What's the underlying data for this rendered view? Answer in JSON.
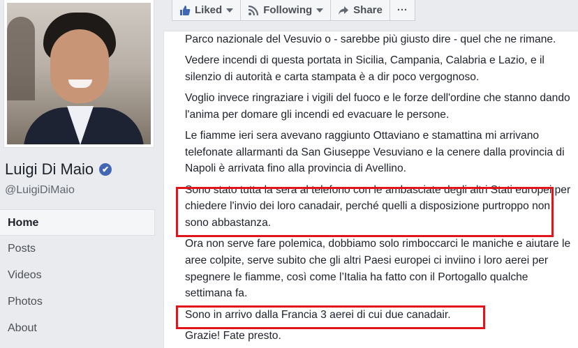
{
  "profile": {
    "name": "Luigi Di Maio",
    "handle": "@LuigiDiMaio",
    "verified_mark": "✔"
  },
  "nav": {
    "items": [
      {
        "label": "Home",
        "active": true
      },
      {
        "label": "Posts"
      },
      {
        "label": "Videos"
      },
      {
        "label": "Photos"
      },
      {
        "label": "About"
      }
    ]
  },
  "actions": {
    "liked_label": "Liked",
    "following_label": "Following",
    "share_label": "Share",
    "more_label": "···"
  },
  "post": {
    "paragraphs": [
      "Parco nazionale del Vesuvio o - sarebbe più giusto dire - quel che ne rimane.",
      "Vedere incendi di questa portata in Sicilia, Campania, Calabria e Lazio, e il silenzio di autorità e carta stampata è a dir poco vergognoso.",
      "Voglio invece ringraziare i vigili del fuoco e le forze dell'ordine che stanno dando l'anima per domare gli incendi ed evacuare le persone.",
      "Le fiamme ieri sera avevano raggiunto Ottaviano e stamattina mi arrivano telefonate allarmanti da San Giuseppe Vesuviano e la cenere dalla provincia di Napoli è arrivata fino alla provincia di Avellino.",
      "Sono stato tutta la sera al telefono con le ambasciate degli altri Stati europei per chiedere l'invio dei loro canadair, perché quelli a disposizione purtroppo non sono abbastanza.",
      "Ora non serve fare polemica, dobbiamo solo rimboccarci le maniche e aiutare le aree colpite, serve subito che gli altri Paesi europei ci inviino i loro aerei per spegnere le fiamme, così come l’Italia ha fatto con il Portogallo qualche settimana fa.",
      "Sono in arrivo dalla Francia 3 aerei di cui due canadair.",
      "Grazie! Fate presto."
    ]
  },
  "colors": {
    "highlight": "#e2131a",
    "facebook_blue": "#4267b2"
  }
}
